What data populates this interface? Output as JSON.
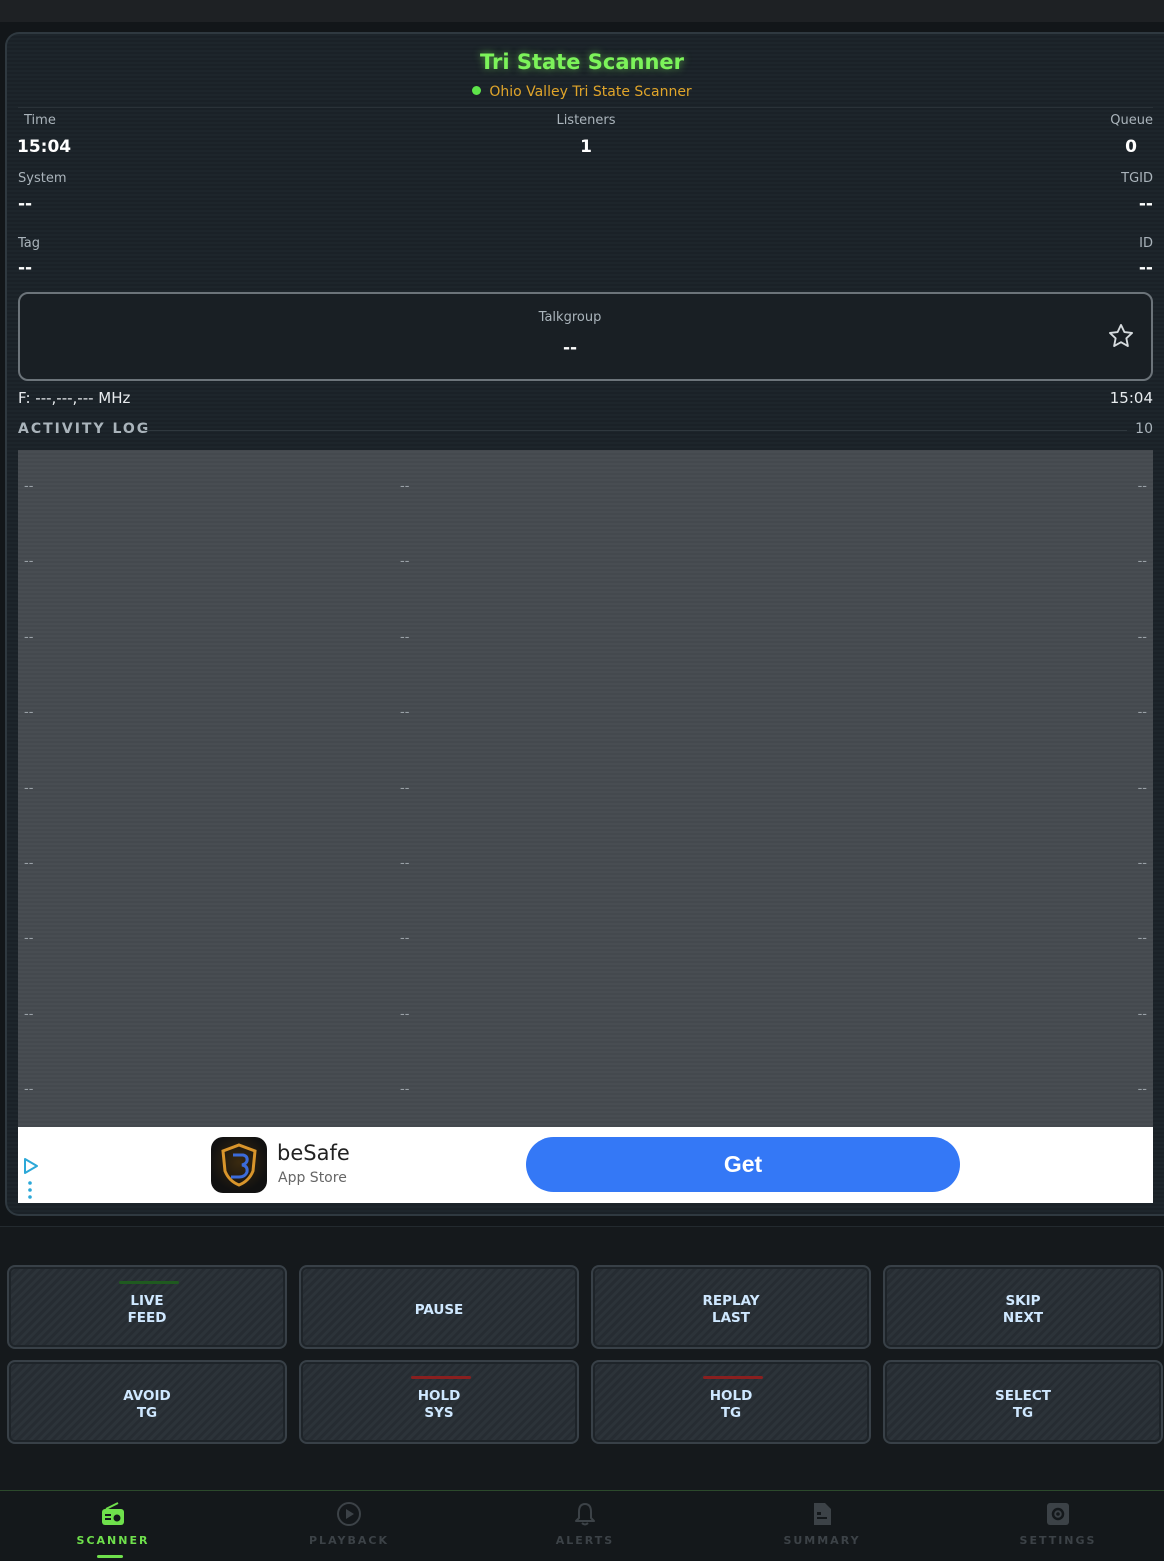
{
  "header": {
    "title": "Tri State Scanner",
    "subtitle": "Ohio Valley Tri State Scanner"
  },
  "stats": {
    "time_label": "Time",
    "time_value": "15:04",
    "listeners_label": "Listeners",
    "listeners_value": "1",
    "queue_label": "Queue",
    "queue_value": "0",
    "system_label": "System",
    "system_value": "--",
    "tgid_label": "TGID",
    "tgid_value": "--",
    "tag_label": "Tag",
    "tag_value": "--",
    "id_label": "ID",
    "id_value": "--"
  },
  "talkgroup": {
    "label": "Talkgroup",
    "value": "--"
  },
  "frequency": {
    "text": "F: ---,---,--- MHz",
    "time": "15:04"
  },
  "activity_log": {
    "title": "ACTIVITY LOG",
    "count": "10",
    "rows": [
      {
        "a": "--",
        "b": "--",
        "c": "--"
      },
      {
        "a": "--",
        "b": "--",
        "c": "--"
      },
      {
        "a": "--",
        "b": "--",
        "c": "--"
      },
      {
        "a": "--",
        "b": "--",
        "c": "--"
      },
      {
        "a": "--",
        "b": "--",
        "c": "--"
      },
      {
        "a": "--",
        "b": "--",
        "c": "--"
      },
      {
        "a": "--",
        "b": "--",
        "c": "--"
      },
      {
        "a": "--",
        "b": "--",
        "c": "--"
      },
      {
        "a": "--",
        "b": "--",
        "c": "--"
      }
    ]
  },
  "ad": {
    "app_name": "beSafe",
    "store": "App Store",
    "cta": "Get"
  },
  "controls": {
    "live_feed": "LIVE\nFEED",
    "pause": "PAUSE",
    "replay_last": "REPLAY\nLAST",
    "skip_next": "SKIP\nNEXT",
    "avoid_tg": "AVOID\nTG",
    "hold_sys": "HOLD\nSYS",
    "hold_tg": "HOLD\nTG",
    "select_tg": "SELECT\nTG"
  },
  "nav": {
    "scanner": "SCANNER",
    "playback": "PLAYBACK",
    "alerts": "ALERTS",
    "summary": "SUMMARY",
    "settings": "SETTINGS"
  },
  "colors": {
    "accent_green": "#7cf35a",
    "subtitle_orange": "#e0a52a",
    "ad_button_blue": "#3478f6",
    "hold_indicator_red": "#8a1f1f",
    "live_indicator_green": "#1f5a1f"
  },
  "icons": {
    "favorite": "star-outline-icon",
    "scanner": "radio-icon",
    "playback": "play-circle-icon",
    "alerts": "bell-icon",
    "summary": "document-icon",
    "settings": "gear-icon",
    "ad_choices": "adchoices-icon"
  }
}
